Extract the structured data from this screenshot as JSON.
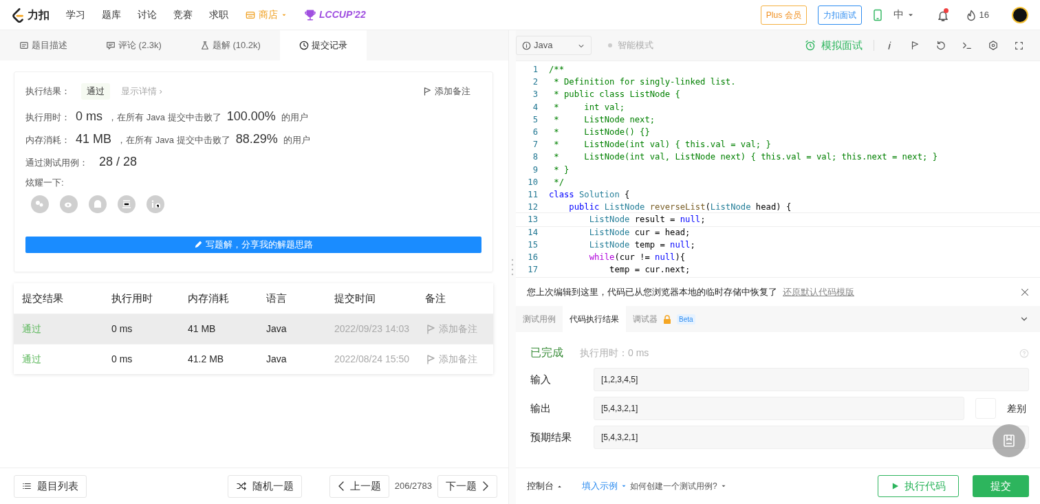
{
  "navbar": {
    "logo_text": "力扣",
    "links": [
      {
        "label": "学习",
        "kind": "plain"
      },
      {
        "label": "题库",
        "kind": "plain"
      },
      {
        "label": "讨论",
        "kind": "plain"
      },
      {
        "label": "竞赛",
        "kind": "plain"
      },
      {
        "label": "求职",
        "kind": "plain"
      },
      {
        "label": "商店",
        "kind": "store"
      },
      {
        "label": "LCCUP’22",
        "kind": "contest"
      }
    ],
    "plus_button": "Plus 会员",
    "interview_button": "力扣面试",
    "language": "中",
    "has_unread": true,
    "streak_count": "16"
  },
  "tabs": [
    {
      "label": "题目描述",
      "selected": false
    },
    {
      "label": "评论 (2.3k)",
      "selected": false
    },
    {
      "label": "题解 (10.2k)",
      "selected": false
    },
    {
      "label": "提交记录",
      "selected": true
    }
  ],
  "result": {
    "label": "执行结果：",
    "value": "通过",
    "details_link": "显示详情 ›",
    "note_button": "添加备注",
    "stats": [
      {
        "label": "执行用时：",
        "value": "0 ms",
        "text": "，在所有 Java 提交中击败了",
        "percent": "100.00%",
        "suffix": "的用户"
      },
      {
        "label": "内存消耗：",
        "value": "41 MB",
        "text": "，在所有 Java 提交中击败了",
        "percent": "88.29%",
        "suffix": "的用户"
      }
    ],
    "tests_label": "通过测试用例：",
    "tests_value": "28 / 28",
    "share_label": "炫耀一下:",
    "write_button": "写题解，分享我的解题思路"
  },
  "submissions": {
    "columns": [
      "提交结果",
      "执行用时",
      "内存消耗",
      "语言",
      "提交时间",
      "备注"
    ],
    "rows": [
      {
        "status": "通过",
        "time": "0 ms",
        "memory": "41 MB",
        "language": "Java",
        "date": "2022/09/23 14:03",
        "note": "添加备注",
        "selected": true
      },
      {
        "status": "通过",
        "time": "0 ms",
        "memory": "41.2 MB",
        "language": "Java",
        "date": "2022/08/24 15:50",
        "note": "添加备注",
        "selected": false
      }
    ]
  },
  "left_footer": {
    "list_button": "题目列表",
    "random_button": "随机一题",
    "prev_button": "上一题",
    "counter": "206/2783",
    "next_button": "下一题"
  },
  "editor_toolbar": {
    "language": "Java",
    "mode": "智能模式",
    "mock_button": "模拟面试"
  },
  "code_lines": [
    {
      "number": "1",
      "selected": false,
      "tokens": [
        {
          "text": "/**",
          "kind": "comment"
        }
      ]
    },
    {
      "number": "2",
      "selected": false,
      "tokens": [
        {
          "text": " * Definition for singly-linked list.",
          "kind": "comment"
        }
      ]
    },
    {
      "number": "3",
      "selected": false,
      "tokens": [
        {
          "text": " * public class ListNode {",
          "kind": "comment"
        }
      ]
    },
    {
      "number": "4",
      "selected": false,
      "tokens": [
        {
          "text": " *     int val;",
          "kind": "comment"
        }
      ]
    },
    {
      "number": "5",
      "selected": false,
      "tokens": [
        {
          "text": " *     ListNode next;",
          "kind": "comment"
        }
      ]
    },
    {
      "number": "6",
      "selected": false,
      "tokens": [
        {
          "text": " *     ListNode() {}",
          "kind": "comment"
        }
      ]
    },
    {
      "number": "7",
      "selected": false,
      "tokens": [
        {
          "text": " *     ListNode(int val) { this.val = val; }",
          "kind": "comment"
        }
      ]
    },
    {
      "number": "8",
      "selected": false,
      "tokens": [
        {
          "text": " *     ListNode(int val, ListNode next) { this.val = val; this.next = next; }",
          "kind": "comment"
        }
      ]
    },
    {
      "number": "9",
      "selected": false,
      "tokens": [
        {
          "text": " * }",
          "kind": "comment"
        }
      ]
    },
    {
      "number": "10",
      "selected": false,
      "tokens": [
        {
          "text": " */",
          "kind": "comment"
        }
      ]
    },
    {
      "number": "11",
      "selected": false,
      "tokens": [
        {
          "text": "class",
          "kind": "keyword"
        },
        {
          "text": " Solution",
          "kind": "type"
        },
        {
          "text": " {",
          "kind": "plain"
        }
      ]
    },
    {
      "number": "12",
      "selected": false,
      "tokens": [
        {
          "text": "    public",
          "kind": "keyword"
        },
        {
          "text": " ListNode",
          "kind": "type"
        },
        {
          "text": " reverseList",
          "kind": "function"
        },
        {
          "text": "(",
          "kind": "plain"
        },
        {
          "text": "ListNode",
          "kind": "type"
        },
        {
          "text": " head) {",
          "kind": "plain"
        }
      ]
    },
    {
      "number": "13",
      "selected": true,
      "tokens": [
        {
          "text": "        ListNode",
          "kind": "type"
        },
        {
          "text": " result = ",
          "kind": "plain"
        },
        {
          "text": "null",
          "kind": "keyword"
        },
        {
          "text": ";",
          "kind": "plain"
        }
      ]
    },
    {
      "number": "14",
      "selected": false,
      "tokens": [
        {
          "text": "        ListNode",
          "kind": "type"
        },
        {
          "text": " cur = head;",
          "kind": "plain"
        }
      ]
    },
    {
      "number": "15",
      "selected": false,
      "tokens": [
        {
          "text": "        ListNode",
          "kind": "type"
        },
        {
          "text": " temp = ",
          "kind": "plain"
        },
        {
          "text": "null",
          "kind": "keyword"
        },
        {
          "text": ";",
          "kind": "plain"
        }
      ]
    },
    {
      "number": "16",
      "selected": false,
      "tokens": [
        {
          "text": "        while",
          "kind": "control"
        },
        {
          "text": "(cur != ",
          "kind": "plain"
        },
        {
          "text": "null",
          "kind": "keyword"
        },
        {
          "text": "){",
          "kind": "plain"
        }
      ]
    },
    {
      "number": "17",
      "selected": false,
      "tokens": [
        {
          "text": "            temp = cur.next;",
          "kind": "plain"
        }
      ]
    }
  ],
  "notice": {
    "text": "您上次编辑到这里，代码已从您浏览器本地的临时存储中恢复了",
    "link": "还原默认代码模版"
  },
  "result_tabs": [
    {
      "label": "测试用例",
      "selected": false,
      "locked": false
    },
    {
      "label": "代码执行结果",
      "selected": true,
      "locked": false
    },
    {
      "label": "调试器",
      "selected": false,
      "locked": true,
      "badge": "Beta"
    }
  ],
  "run_result": {
    "status": "已完成",
    "runtime": "执行用时：0 ms",
    "fields": [
      {
        "label": "输入",
        "value": "[1,2,3,4,5]"
      },
      {
        "label": "输出",
        "value": "[5,4,3,2,1]",
        "diff": {
          "label": "差别",
          "on": false
        }
      },
      {
        "label": "预期结果",
        "value": "[5,4,3,2,1]"
      }
    ]
  },
  "console_bar": {
    "console": "控制台",
    "fill_example": "填入示例",
    "how_to": "如何创建一个测试用例?",
    "run_button": "执行代码",
    "submit_button": "提交"
  }
}
